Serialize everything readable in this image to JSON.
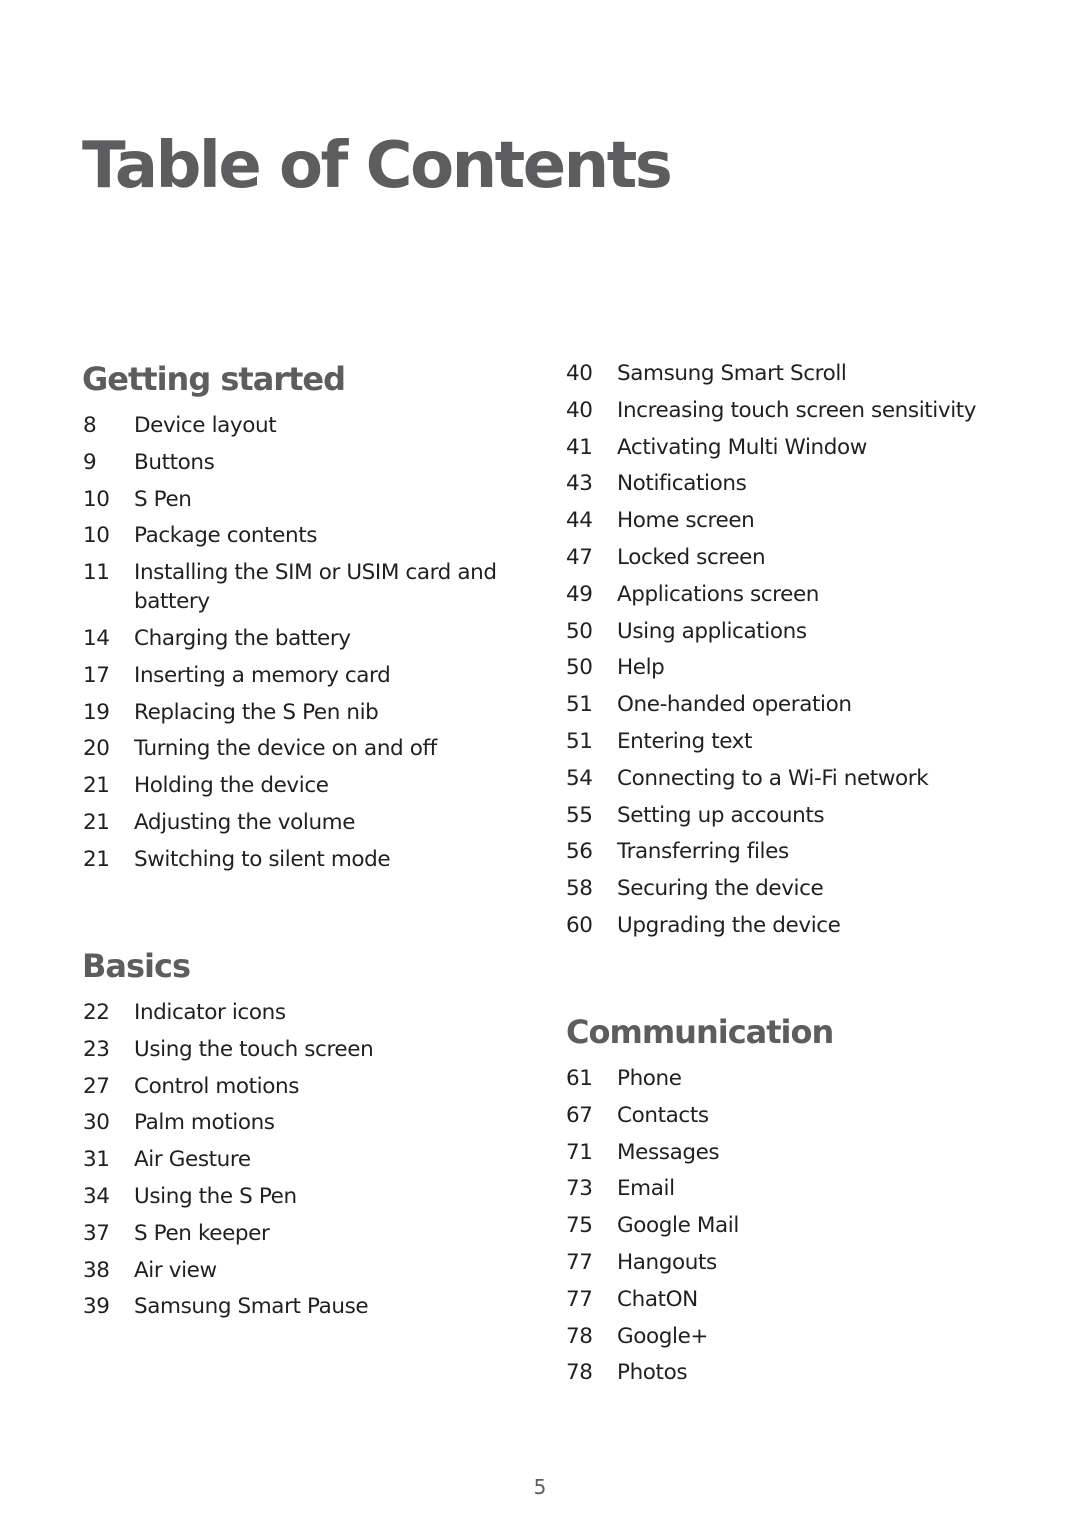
{
  "title": "Table of Contents",
  "page_number": "5",
  "sections": [
    {
      "title": "Getting started",
      "entries": [
        {
          "page": "8",
          "label": "Device layout"
        },
        {
          "page": "9",
          "label": "Buttons"
        },
        {
          "page": "10",
          "label": "S Pen"
        },
        {
          "page": "10",
          "label": "Package contents"
        },
        {
          "page": "11",
          "label": "Installing the SIM or USIM card and battery"
        },
        {
          "page": "14",
          "label": "Charging the battery"
        },
        {
          "page": "17",
          "label": "Inserting a memory card"
        },
        {
          "page": "19",
          "label": "Replacing the S Pen nib"
        },
        {
          "page": "20",
          "label": "Turning the device on and off"
        },
        {
          "page": "21",
          "label": "Holding the device"
        },
        {
          "page": "21",
          "label": "Adjusting the volume"
        },
        {
          "page": "21",
          "label": "Switching to silent mode"
        }
      ]
    },
    {
      "title": "Basics",
      "entries": [
        {
          "page": "22",
          "label": "Indicator icons"
        },
        {
          "page": "23",
          "label": "Using the touch screen"
        },
        {
          "page": "27",
          "label": "Control motions"
        },
        {
          "page": "30",
          "label": "Palm motions"
        },
        {
          "page": "31",
          "label": "Air Gesture"
        },
        {
          "page": "34",
          "label": "Using the S Pen"
        },
        {
          "page": "37",
          "label": "S Pen keeper"
        },
        {
          "page": "38",
          "label": "Air view"
        },
        {
          "page": "39",
          "label": "Samsung Smart Pause"
        },
        {
          "page": "40",
          "label": "Samsung Smart Scroll"
        },
        {
          "page": "40",
          "label": "Increasing touch screen sensitivity"
        },
        {
          "page": "41",
          "label": "Activating Multi Window"
        },
        {
          "page": "43",
          "label": "Notifications"
        },
        {
          "page": "44",
          "label": "Home screen"
        },
        {
          "page": "47",
          "label": "Locked screen"
        },
        {
          "page": "49",
          "label": "Applications screen"
        },
        {
          "page": "50",
          "label": "Using applications"
        },
        {
          "page": "50",
          "label": "Help"
        },
        {
          "page": "51",
          "label": "One-handed operation"
        },
        {
          "page": "51",
          "label": "Entering text"
        },
        {
          "page": "54",
          "label": "Connecting to a Wi-Fi network"
        },
        {
          "page": "55",
          "label": "Setting up accounts"
        },
        {
          "page": "56",
          "label": "Transferring files"
        },
        {
          "page": "58",
          "label": "Securing the device"
        },
        {
          "page": "60",
          "label": "Upgrading the device"
        }
      ]
    },
    {
      "title": "Communication",
      "entries": [
        {
          "page": "61",
          "label": "Phone"
        },
        {
          "page": "67",
          "label": "Contacts"
        },
        {
          "page": "71",
          "label": "Messages"
        },
        {
          "page": "73",
          "label": "Email"
        },
        {
          "page": "75",
          "label": "Google Mail"
        },
        {
          "page": "77",
          "label": "Hangouts"
        },
        {
          "page": "77",
          "label": "ChatON"
        },
        {
          "page": "78",
          "label": "Google+"
        },
        {
          "page": "78",
          "label": "Photos"
        }
      ]
    }
  ]
}
